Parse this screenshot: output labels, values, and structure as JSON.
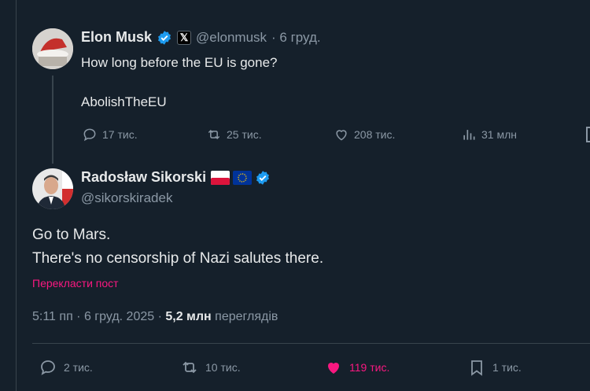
{
  "colors": {
    "background": "#15202b",
    "text": "#e7e9ea",
    "muted": "#8b98a5",
    "verified": "#1d9bf0",
    "like": "#f91880",
    "link": "#f91880"
  },
  "quoted_post": {
    "author_name": "Elon Musk",
    "handle": "@elonmusk",
    "date": "· 6 груд.",
    "line1": "How long before the EU is gone?",
    "line2": "AbolishTheEU",
    "replies": "17 тис.",
    "reposts": "25 тис.",
    "likes": "208 тис.",
    "views": "31 млн",
    "icons": [
      "verified-badge-icon",
      "x-affiliate-icon",
      "reply-icon",
      "repost-icon",
      "heart-icon",
      "views-icon"
    ]
  },
  "main_post": {
    "author_name": "Radosław Sikorski",
    "handle": "@sikorskiradek",
    "text_line1": "Go to Mars.",
    "text_line2": "There's no censorship of Nazi salutes there.",
    "translate_link": "Перекласти пост",
    "timestamp": "5:11 пп · 6 груд. 2025 · ",
    "views_count": "5,2 млн",
    "views_label": " переглядів",
    "replies": "2 тис.",
    "reposts": "10 тис.",
    "likes": "119 тис.",
    "bookmarks": "1 тис.",
    "icons": [
      "poland-flag-icon",
      "eu-flag-icon",
      "verified-badge-icon",
      "reply-icon",
      "repost-icon",
      "heart-filled-icon",
      "bookmark-icon"
    ]
  }
}
